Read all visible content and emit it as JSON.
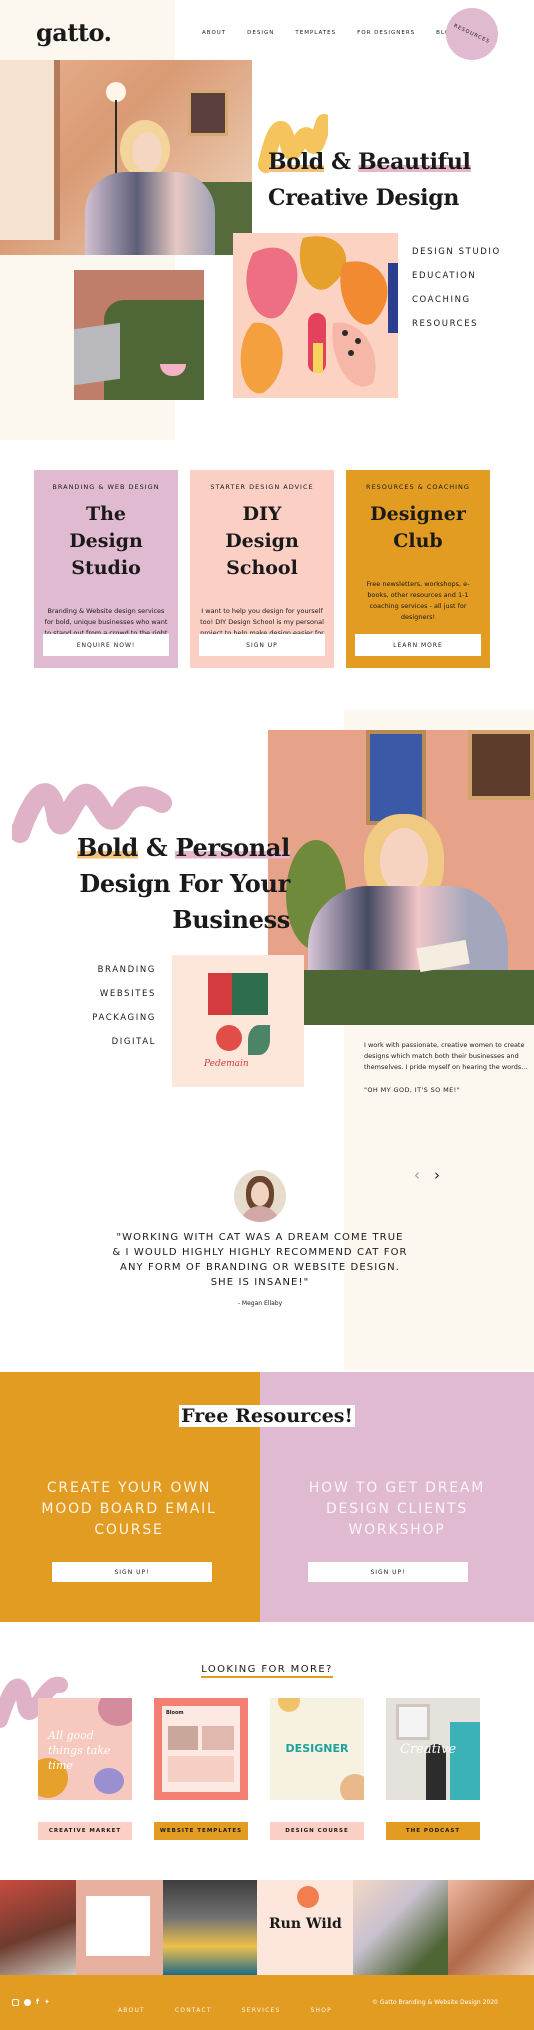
{
  "header": {
    "logo": "gatto.",
    "nav": [
      "ABOUT",
      "DESIGN",
      "TEMPLATES",
      "FOR DESIGNERS",
      "BLOG"
    ],
    "resources_label": "RESOURCES"
  },
  "hero": {
    "headline_bold": "Bold",
    "headline_amp": " & ",
    "headline_beautiful": "Beautiful",
    "headline_line2": "Creative Design",
    "links": [
      "DESIGN STUDIO",
      "EDUCATION",
      "COACHING",
      "RESOURCES"
    ]
  },
  "cards": [
    {
      "kicker": "BRANDING & WEB DESIGN",
      "title": "The Design Studio",
      "text": "Branding & Website design services for bold, unique businesses who want to stand out from a crowd to the right people.",
      "button": "ENQUIRE NOW!"
    },
    {
      "kicker": "STARTER DESIGN ADVICE",
      "title": "DIY Design School",
      "text": "I want to help you design for yourself too! DIY Design School is my personal project to help make design easier for you.",
      "button": "SIGN UP"
    },
    {
      "kicker": "RESOURCES & COACHING",
      "title": "Designer Club",
      "text": "Free newsletters, workshops, e-books, other resources and 1-1 coaching services - all just for designers!",
      "button": "LEARN MORE"
    }
  ],
  "personal": {
    "headline_bold": "Bold",
    "headline_amp": " & ",
    "headline_personal": "Personal",
    "headline_line2": "Design For Your",
    "headline_line3": "Business",
    "services": [
      "BRANDING",
      "WEBSITES",
      "PACKAGING",
      "DIGITAL"
    ],
    "bio": "I work with passionate, creative women to create designs which match both their businesses and themselves. I pride myself on hearing the words...",
    "quote": "\"OH MY GOD, IT'S SO ME!\"",
    "packaging_label": "Pedemain"
  },
  "testimonial": {
    "text": "\"WORKING WITH CAT WAS A DREAM COME TRUE & I WOULD HIGHLY HIGHLY RECOMMEND CAT FOR ANY FORM OF BRANDING OR WEBSITE DESIGN. SHE IS INSANE!\"",
    "author": "- Megan Ellaby"
  },
  "free_resources": {
    "title": "Free Resources!",
    "left_text": "CREATE YOUR OWN MOOD BOARD EMAIL COURSE",
    "left_button": "SIGN UP!",
    "right_text": "HOW TO GET DREAM DESIGN CLIENTS WORKSHOP",
    "right_button": "SIGN UP!"
  },
  "more": {
    "title": "LOOKING FOR MORE?",
    "items": [
      {
        "label": "CREATIVE MARKET",
        "thumb_text": "All good things take time"
      },
      {
        "label": "WEBSITE TEMPLATES",
        "thumb_text": "Bloom"
      },
      {
        "label": "DESIGN COURSE",
        "thumb_text": "DESIGNER"
      },
      {
        "label": "THE PODCAST",
        "thumb_text": "Creative"
      }
    ]
  },
  "instagram": {
    "runwild": "Run Wild"
  },
  "footer": {
    "social": [
      "instagram-icon",
      "pinterest-icon",
      "facebook-icon",
      "twitter-icon"
    ],
    "nav": [
      "ABOUT",
      "CONTACT",
      "SERVICES",
      "SHOP"
    ],
    "copyright": "© Gatto Branding & Website Design 2020"
  },
  "colors": {
    "pink": "#dfbad0",
    "peach": "#fbcfc4",
    "mustard": "#e29c22",
    "cream": "#fdf8ef"
  }
}
